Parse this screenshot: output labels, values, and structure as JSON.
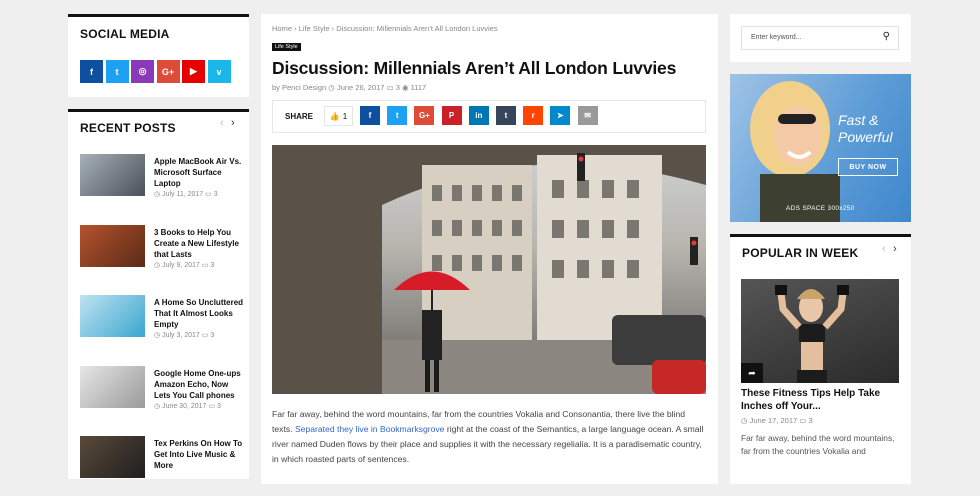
{
  "social": {
    "title": "Social Media",
    "icons": [
      {
        "name": "facebook-icon",
        "glyph": "f",
        "color": "#0e4fa0"
      },
      {
        "name": "twitter-icon",
        "glyph": "t",
        "color": "#1da1f2"
      },
      {
        "name": "instagram-icon",
        "glyph": "◎",
        "color": "#8a3ab9"
      },
      {
        "name": "google-plus-icon",
        "glyph": "G+",
        "color": "#dd4b39"
      },
      {
        "name": "youtube-icon",
        "glyph": "▶",
        "color": "#e60000"
      },
      {
        "name": "vimeo-icon",
        "glyph": "v",
        "color": "#1ab7ea"
      }
    ]
  },
  "recent": {
    "title": "Recent Posts",
    "posts": [
      {
        "title": "Apple MacBook Air Vs. Microsoft Surface Laptop",
        "date": "July 11, 2017",
        "comments": "3"
      },
      {
        "title": "3 Books to Help You Create a New Lifestyle that Lasts",
        "date": "July 9, 2017",
        "comments": "3"
      },
      {
        "title": "A Home So Uncluttered That It Almost Looks Empty",
        "date": "July 3, 2017",
        "comments": "3"
      },
      {
        "title": "Google Home One-ups Amazon Echo, Now Lets You Call phones",
        "date": "June 30, 2017",
        "comments": "3"
      },
      {
        "title": "Tex Perkins On How To Get Into Live Music & More",
        "date": "",
        "comments": ""
      }
    ]
  },
  "article": {
    "breadcrumb": [
      "Home",
      "Life Style",
      "Discussion: Millennials Aren’t All London Luvvies"
    ],
    "category": "Life Style",
    "title": "Discussion: Millennials Aren’t All London Luvvies",
    "author": "by Penci Design",
    "date": "June 26, 2017",
    "comments": "3",
    "views": "1117",
    "share_label": "SHARE",
    "likes": "1",
    "share_buttons": [
      {
        "name": "share-facebook-button",
        "glyph": "f",
        "color": "#0e4fa0"
      },
      {
        "name": "share-twitter-button",
        "glyph": "t",
        "color": "#1da1f2"
      },
      {
        "name": "share-google-button",
        "glyph": "G+",
        "color": "#dd4b39"
      },
      {
        "name": "share-pinterest-button",
        "glyph": "P",
        "color": "#cb2027"
      },
      {
        "name": "share-linkedin-button",
        "glyph": "in",
        "color": "#0077b5"
      },
      {
        "name": "share-tumblr-button",
        "glyph": "t",
        "color": "#35465c"
      },
      {
        "name": "share-reddit-button",
        "glyph": "r",
        "color": "#ff4500"
      },
      {
        "name": "share-telegram-button",
        "glyph": "➤",
        "color": "#0088cc"
      },
      {
        "name": "share-email-button",
        "glyph": "✉",
        "color": "#999999"
      }
    ],
    "body_1": "Far far away, behind the word mountains, far from the countries Vokalia and Consonantia, there live the blind texts. ",
    "body_link": "Separated they live in Bookmarksgrove",
    "body_2": " right at the coast of the Semantics, a large language ocean. A small river named Duden flows by their place and supplies it with the necessary regelialia. It is a paradisematic country, in which roasted parts of sentences."
  },
  "search": {
    "placeholder": "Enter keyword..."
  },
  "ad": {
    "headline_1": "Fast &",
    "headline_2": "Powerful",
    "button": "BUY NOW",
    "caption": "ADS SPACE 300x250"
  },
  "popular": {
    "title": "Popular In Week",
    "post_title": "These Fitness Tips Help Take Inches off Your...",
    "date": "June 17, 2017",
    "comments": "3",
    "excerpt": "Far far away, behind the word mountains, far from the countries Vokalia and"
  }
}
